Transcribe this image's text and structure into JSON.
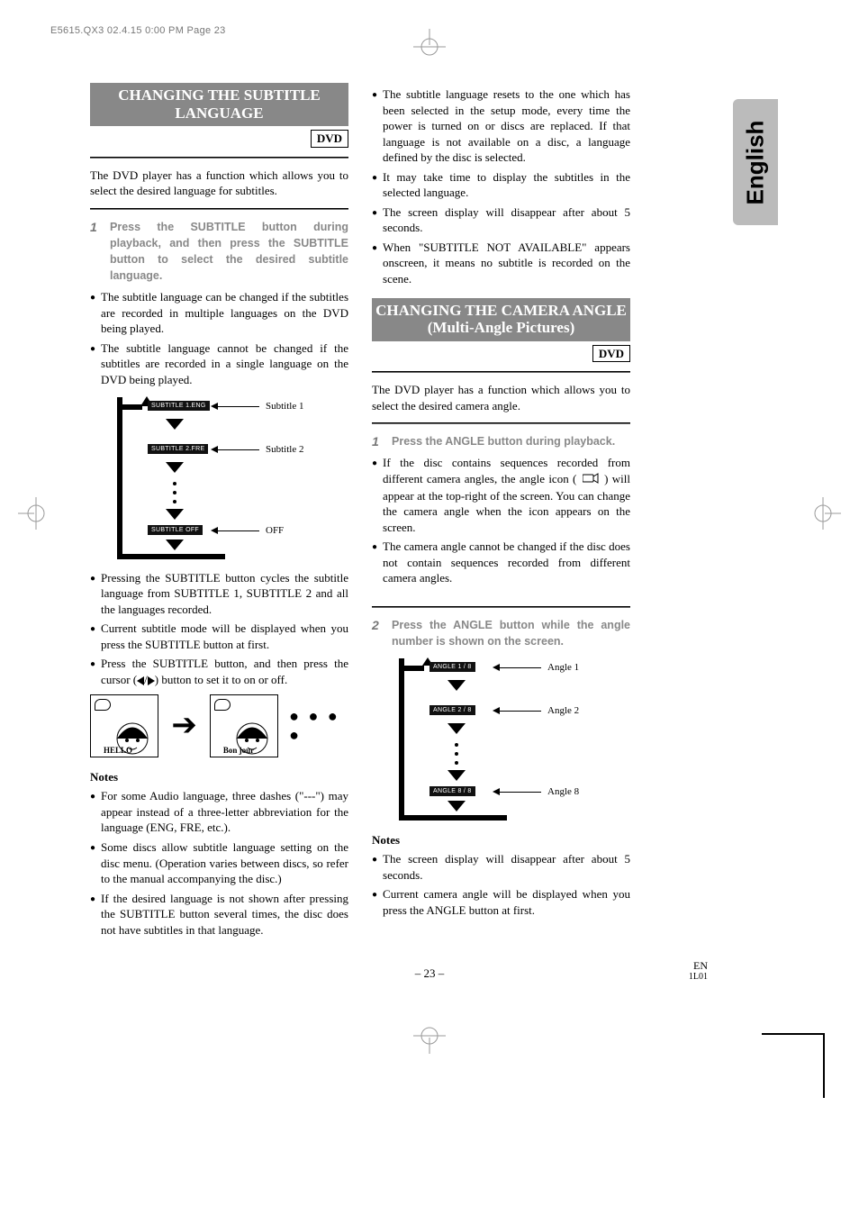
{
  "print_header": "E5615.QX3  02.4.15 0:00 PM  Page 23",
  "side_tab": "English",
  "section1": {
    "title": "CHANGING THE SUBTITLE LANGUAGE",
    "badge": "DVD",
    "intro": "The DVD player has a function which allows you to select the desired language for subtitles.",
    "step1_num": "1",
    "step1": "Press the SUBTITLE button during playback, and then press the SUBTITLE button to select the desired subtitle language.",
    "b1": "The subtitle language can be changed if the subtitles are recorded in multiple languages on the DVD being played.",
    "b2": "The subtitle language cannot be changed if the subtitles are recorded in a single language on the DVD being played.",
    "diag": {
      "osd1": "SUBTITLE 1.ENG",
      "osd2": "SUBTITLE 2.FRE",
      "osd3": "SUBTITLE OFF",
      "lab1": "Subtitle 1",
      "lab2": "Subtitle 2",
      "lab3": "OFF"
    },
    "b3": "Pressing the SUBTITLE button cycles the subtitle language from SUBTITLE 1, SUBTITLE 2 and all the languages recorded.",
    "b4": "Current subtitle mode will be displayed when you press the SUBTITLE button at first.",
    "b5_a": "Press the SUBTITLE button, and then press the cursor (",
    "b5_b": ") button to set it to on or off.",
    "cartoon": {
      "hello": "HELLO",
      "bonjour": "Bon jour"
    },
    "notes_title": "Notes",
    "n1": "For some Audio language, three dashes (\"---\") may appear instead of a three-letter abbreviation for the language (ENG, FRE, etc.).",
    "n2": "Some discs allow subtitle language setting on the disc menu. (Operation varies between discs, so refer to the manual accompanying the disc.)",
    "n3": "If the desired language is not shown after pressing the SUBTITLE button several times, the disc does not have subtitles in that language.",
    "n4": "The subtitle language resets to the one which has been selected in the setup mode, every time the power is turned on or discs are replaced. If that language is not available on a disc, a language defined by the disc is selected.",
    "n5": "It may take time to display the subtitles in the selected language.",
    "n6": "The screen display will disappear after about 5 seconds.",
    "n7": "When \"SUBTITLE NOT AVAILABLE\" appears onscreen, it means no subtitle is recorded on the scene."
  },
  "section2": {
    "title": "CHANGING THE CAMERA ANGLE (Multi-Angle Pictures)",
    "badge": "DVD",
    "intro": "The DVD player has a function which allows you to select the desired camera angle.",
    "step1_num": "1",
    "step1": "Press the ANGLE button during playback.",
    "b1_a": "If the disc contains sequences recorded from different camera angles, the angle icon (",
    "b1_b": ") will appear at the top-right of the screen. You can change the camera angle when the icon appears on the screen.",
    "b2": "The camera angle cannot be changed if the disc does not contain sequences recorded from different camera angles.",
    "step2_num": "2",
    "step2": "Press the ANGLE button while the angle number is shown on the screen.",
    "diag": {
      "osd1": "ANGLE  1 / 8",
      "osd2": "ANGLE  2 / 8",
      "osd3": "ANGLE  8 / 8",
      "lab1": "Angle 1",
      "lab2": "Angle 2",
      "lab3": "Angle 8"
    },
    "notes_title": "Notes",
    "n1": "The screen display will disappear after about 5 seconds.",
    "n2": "Current camera angle will be displayed when you press the ANGLE button at first."
  },
  "footer": {
    "pagenum": "– 23 –",
    "right1": "EN",
    "right2": "1L01"
  }
}
